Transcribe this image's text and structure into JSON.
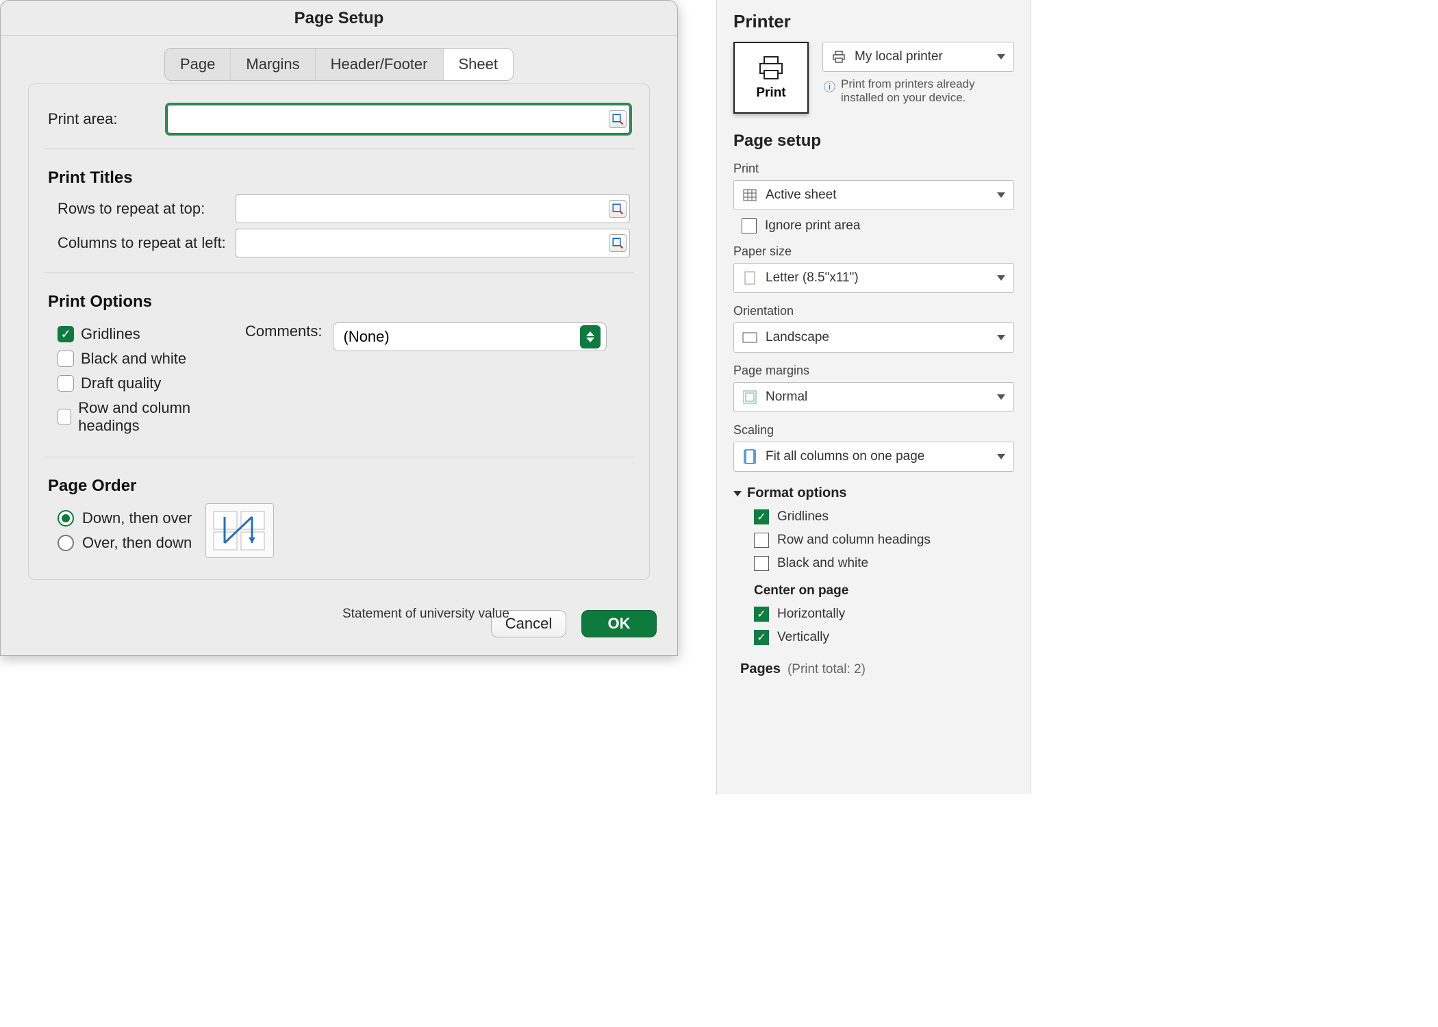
{
  "dialog": {
    "title": "Page Setup",
    "tabs": {
      "page": "Page",
      "margins": "Margins",
      "headerfooter": "Header/Footer",
      "sheet": "Sheet"
    },
    "activeTab": "sheet",
    "print_area_label": "Print area:",
    "print_titles": {
      "heading": "Print Titles",
      "rows_label": "Rows to repeat at top:",
      "cols_label": "Columns to repeat at left:"
    },
    "print_options": {
      "heading": "Print Options",
      "gridlines": "Gridlines",
      "bw": "Black and white",
      "draft": "Draft quality",
      "headings": "Row and column headings",
      "comments_label": "Comments:",
      "comments_value": "(None)",
      "checks": {
        "gridlines": true,
        "bw": false,
        "draft": false,
        "headings": false
      }
    },
    "page_order": {
      "heading": "Page Order",
      "down_then_over": "Down, then over",
      "over_then_down": "Over, then down",
      "selected": "down_then_over"
    },
    "buttons": {
      "cancel": "Cancel",
      "ok": "OK"
    }
  },
  "behind_text": "Statement of university value",
  "sidepane": {
    "printer_heading": "Printer",
    "print_tile_label": "Print",
    "printer_dropdown": "My local printer",
    "printer_info": "Print from printers already installed on your device.",
    "page_setup_heading": "Page setup",
    "print": {
      "label": "Print",
      "value": "Active sheet"
    },
    "ignore_print_area": {
      "label": "Ignore print area",
      "checked": false
    },
    "paper": {
      "label": "Paper size",
      "value": "Letter (8.5\"x11\")"
    },
    "orientation": {
      "label": "Orientation",
      "value": "Landscape"
    },
    "margins": {
      "label": "Page margins",
      "value": "Normal"
    },
    "scaling": {
      "label": "Scaling",
      "value": "Fit all columns on one page"
    },
    "format_options": {
      "title": "Format options",
      "gridlines": {
        "label": "Gridlines",
        "checked": true
      },
      "headings": {
        "label": "Row and column headings",
        "checked": false
      },
      "bw": {
        "label": "Black and white",
        "checked": false
      },
      "center_heading": "Center on page",
      "horizontally": {
        "label": "Horizontally",
        "checked": true
      },
      "vertically": {
        "label": "Vertically",
        "checked": true
      }
    },
    "pages": {
      "label": "Pages",
      "total_text": "(Print total: 2)"
    }
  }
}
